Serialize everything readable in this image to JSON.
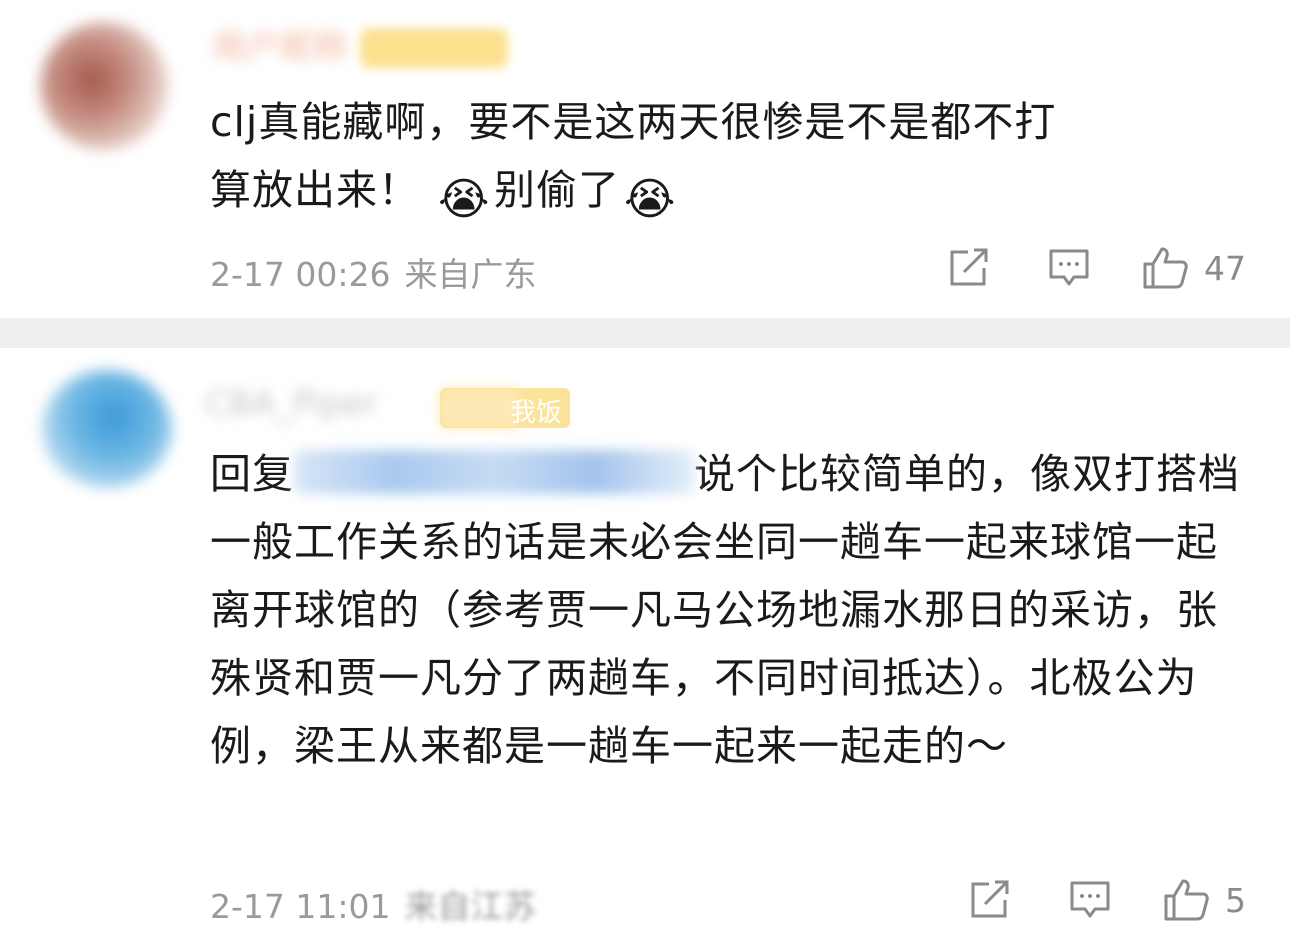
{
  "comments": [
    {
      "username": "用户昵称",
      "text_line1": "clj真能藏啊，要不是这两天很惨是不是都不打",
      "text_line2_a": "算放出来！",
      "text_line2_b": "别偷了",
      "emoji": "😭",
      "time": "2-17 00:26",
      "location": "来自广东",
      "likes": "47"
    },
    {
      "username": "CBA_Piper",
      "badge": "我饭",
      "reply_prefix": "回复",
      "text_after_mention": "说个比较简单的，像双打搭档一般工作关系的话是未必会坐同一趟车一起来球馆一起离开球馆的（参考贾一凡马公场地漏水那日的采访，张殊贤和贾一凡分了两趟车，不同时间抵达）。北极公为例，梁王从来都是一趟车一起来一起走的～",
      "time": "2-17 11:01",
      "location": "来自江苏",
      "likes": "5"
    }
  ],
  "icons": {
    "share": "share-icon",
    "reply": "comment-icon",
    "like": "thumbs-up-icon"
  },
  "colors": {
    "text": "#1a1a1a",
    "meta": "#9a9a9a",
    "separator": "#efefef"
  }
}
